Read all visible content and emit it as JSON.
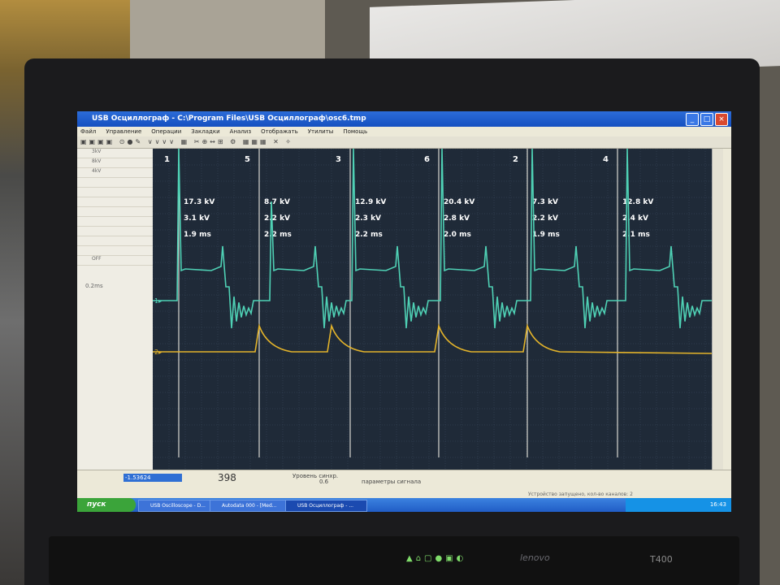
{
  "window": {
    "title": "USB Осциллограф - C:\\Program Files\\USB Осциллограф\\osc6.tmp"
  },
  "menu": [
    "Файл",
    "Управление",
    "Операции",
    "Закладки",
    "Анализ",
    "Отображать",
    "Утилиты",
    "Помощь"
  ],
  "plot": {
    "cylinders": [
      {
        "label": "1",
        "kv_peak": "17.3 kV",
        "kv_burn": "3.1 kV",
        "duration": "1.9 ms"
      },
      {
        "label": "5",
        "kv_peak": "8.7 kV",
        "kv_burn": "2.2 kV",
        "duration": "2.2 ms"
      },
      {
        "label": "3",
        "kv_peak": "12.9 kV",
        "kv_burn": "2.3 kV",
        "duration": "2.2 ms"
      },
      {
        "label": "6",
        "kv_peak": "20.4 kV",
        "kv_burn": "2.8 kV",
        "duration": "2.0 ms"
      },
      {
        "label": "2",
        "kv_peak": "7.3 kV",
        "kv_burn": "2.2 kV",
        "duration": "1.9 ms"
      },
      {
        "label": "4",
        "kv_peak": "12.8 kV",
        "kv_burn": "2.4 kV",
        "duration": "2.1 ms"
      }
    ],
    "channel1_label": "1",
    "channel2_label": "2",
    "colors": {
      "ch1": "#4fd1b5",
      "ch2": "#e3b32a",
      "bg": "#1f2a38",
      "grid": "#3b4a5e",
      "marker": "#d8d8d0"
    }
  },
  "sidepanel": {
    "rows": [
      "3kV",
      "8kV",
      "4kV",
      "",
      "",
      "",
      "",
      "",
      "",
      "",
      "",
      "OFF"
    ],
    "time": "0.2ms"
  },
  "bottombar": {
    "time_value": "-1.53624",
    "counter": "398",
    "level_label": "Уровень синхр.",
    "level_value": "0.6",
    "params_label": "параметры сигнала",
    "status": "Устройство запущено, кол-во каналов: 2"
  },
  "taskbar": {
    "start": "пуск",
    "tasks": [
      "USB Oscilloscope - D...",
      "Autodata 000 - [Med...",
      "USB Осциллограф - ..."
    ],
    "clock": "16:43"
  },
  "laptop": {
    "brand": "lenovo",
    "model": "T400"
  }
}
